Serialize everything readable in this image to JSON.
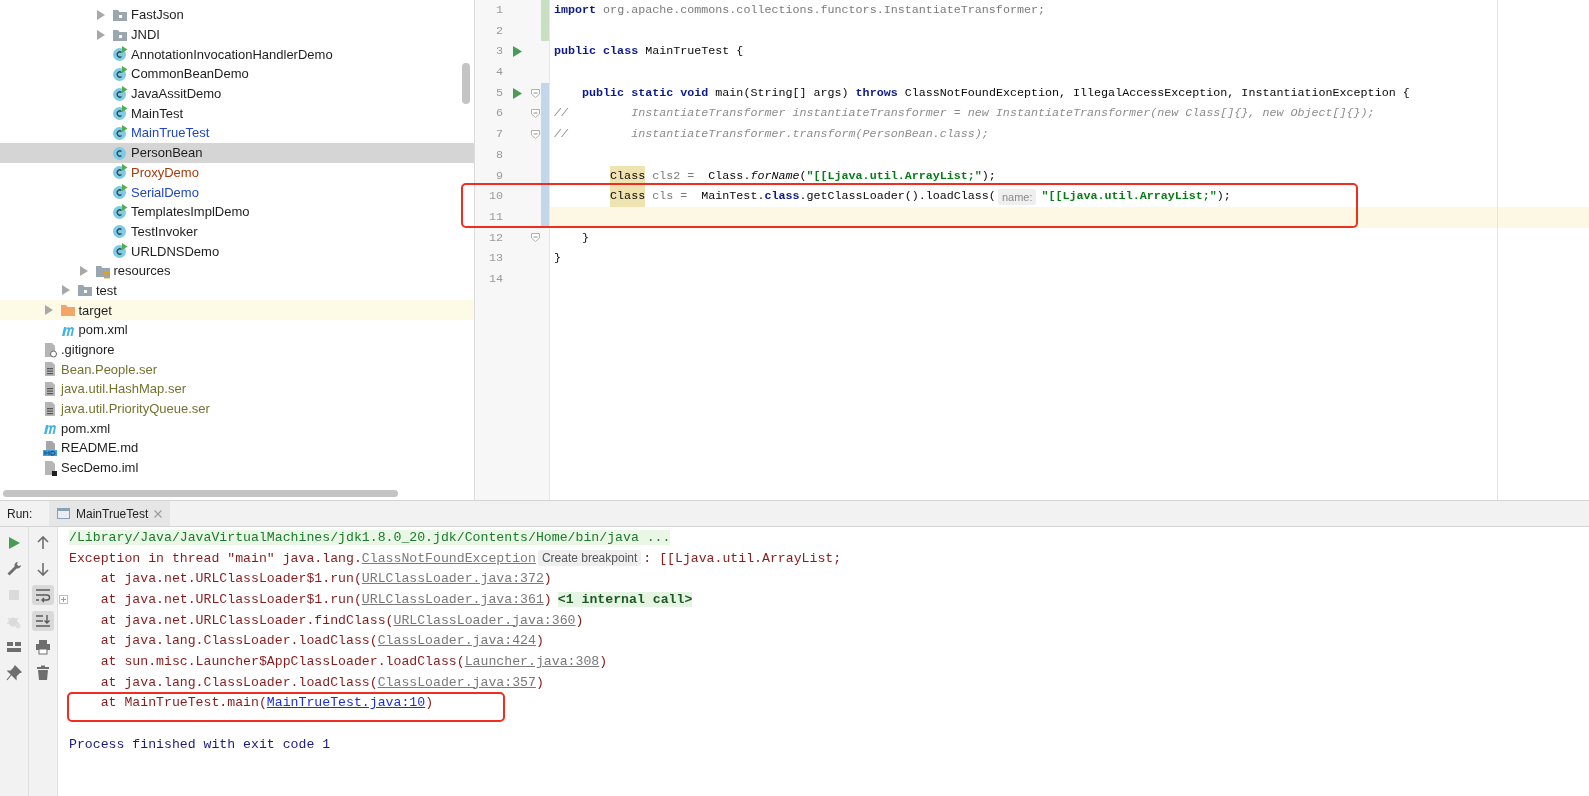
{
  "project_tree": {
    "items": [
      {
        "children": [
          {
            "children": [
              {
                "children": [
                  {
                    "children": [
                      {
                        "label": "FastJson",
                        "kind": "folder",
                        "color": "#1e1e1e",
                        "selected": false,
                        "expanded": false
                      },
                      {
                        "label": "JNDI",
                        "kind": "folder",
                        "color": "#1e1e1e",
                        "selected": false,
                        "expanded": false
                      },
                      {
                        "label": "AnnotationInvocationHandlerDemo",
                        "kind": "class-main",
                        "color": "#1e1e1e",
                        "selected": false
                      },
                      {
                        "label": "CommonBeanDemo",
                        "kind": "class-main",
                        "color": "#1e1e1e",
                        "selected": false
                      },
                      {
                        "label": "JavaAssitDemo",
                        "kind": "class-main",
                        "color": "#1e1e1e",
                        "selected": false
                      },
                      {
                        "label": "MainTest",
                        "kind": "class-main",
                        "color": "#1e1e1e",
                        "selected": false
                      },
                      {
                        "label": "MainTrueTest",
                        "kind": "class-main",
                        "color": "#1f46c8",
                        "selected": false
                      },
                      {
                        "label": "PersonBean",
                        "kind": "class",
                        "color": "#1e1e1e",
                        "selected": true
                      },
                      {
                        "label": "ProxyDemo",
                        "kind": "class-main",
                        "color": "#a8390a",
                        "selected": false
                      },
                      {
                        "label": "SerialDemo",
                        "kind": "class-main",
                        "color": "#1f46c8",
                        "selected": false
                      },
                      {
                        "label": "TemplatesImplDemo",
                        "kind": "class-main",
                        "color": "#1e1e1e",
                        "selected": false
                      },
                      {
                        "label": "TestInvoker",
                        "kind": "class",
                        "color": "#1e1e1e",
                        "selected": false
                      },
                      {
                        "label": "URLDNSDemo",
                        "kind": "class-main",
                        "color": "#1e1e1e",
                        "selected": false
                      }
                    ]
                  },
                  {
                    "label": "resources",
                    "kind": "resources",
                    "color": "#1e1e1e",
                    "selected": false,
                    "expanded": false
                  }
                ]
              },
              {
                "label": "test",
                "kind": "folder",
                "color": "#1e1e1e",
                "selected": false,
                "expanded": false
              }
            ]
          },
          {
            "label": "target",
            "kind": "excluded",
            "color": "#1e1e1e",
            "selected": false,
            "expanded": false
          },
          {
            "label": "pom.xml",
            "kind": "maven",
            "color": "#1e1e1e",
            "selected": false
          }
        ]
      },
      {
        "label": ".gitignore",
        "kind": "gitignore",
        "color": "#1e1e1e",
        "selected": false
      },
      {
        "label": "Bean.People.ser",
        "kind": "text-file",
        "color": "#737330",
        "selected": false
      },
      {
        "label": "java.util.HashMap.ser",
        "kind": "text-file",
        "color": "#737330",
        "selected": false
      },
      {
        "label": "java.util.PriorityQueue.ser",
        "kind": "text-file",
        "color": "#737330",
        "selected": false
      },
      {
        "label": "pom.xml",
        "kind": "maven",
        "color": "#1e1e1e",
        "selected": false
      },
      {
        "label": "README.md",
        "kind": "markdown",
        "color": "#1e1e1e",
        "selected": false
      },
      {
        "label": "SecDemo.iml",
        "kind": "iml",
        "color": "#1e1e1e",
        "selected": false
      }
    ]
  },
  "editor": {
    "lines": [
      {
        "number": "1",
        "kind": "added",
        "runnable": false,
        "fold": false,
        "current": false,
        "tokens": [
          {
            "kind": "keyword",
            "text": "import"
          },
          {
            "kind": "unused",
            "text": " org.apache.commons.collections.functors.InstantiateTransformer;"
          }
        ]
      },
      {
        "number": "2",
        "kind": "added",
        "runnable": false,
        "fold": false,
        "current": false
      },
      {
        "number": "3",
        "kind": "unchanged",
        "runnable": true,
        "fold": false,
        "current": false,
        "tokens": [
          {
            "kind": "keyword",
            "text": "public class"
          },
          {
            "kind": "plain",
            "text": " MainTrueTest {"
          }
        ]
      },
      {
        "number": "4",
        "kind": "unchanged",
        "runnable": false,
        "fold": false,
        "current": false
      },
      {
        "number": "5",
        "kind": "modified",
        "runnable": true,
        "fold": true,
        "current": false,
        "tokens": [
          {
            "kind": "keyword",
            "text": "    public static void"
          },
          {
            "kind": "plain",
            "text": " main(String[] args) "
          },
          {
            "kind": "keyword",
            "text": "throws"
          },
          {
            "kind": "plain",
            "text": " ClassNotFoundException, IllegalAccessException, InstantiationException {"
          }
        ]
      },
      {
        "number": "6",
        "kind": "modified",
        "runnable": false,
        "fold": true,
        "current": false,
        "tokens": [
          {
            "kind": "comment",
            "text": "//         InstantiateTransformer instantiateTransformer = new InstantiateTransformer(new Class[]{}, new Object[]{});"
          }
        ]
      },
      {
        "number": "7",
        "kind": "modified",
        "runnable": false,
        "fold": true,
        "current": false,
        "tokens": [
          {
            "kind": "comment",
            "text": "//         instantiateTransformer.transform(PersonBean.class);"
          }
        ]
      },
      {
        "number": "8",
        "kind": "modified",
        "runnable": false,
        "fold": false,
        "current": false
      },
      {
        "number": "9",
        "kind": "modified",
        "runnable": false,
        "fold": false,
        "current": false,
        "tokens": [
          {
            "kind": "usage",
            "text": "Class"
          },
          {
            "kind": "unused",
            "text": " cls2 ="
          },
          {
            "kind": "plain",
            "text": "  Class."
          },
          {
            "kind": "static",
            "text": "forName"
          },
          {
            "kind": "plain",
            "text": "("
          },
          {
            "kind": "string",
            "text": "\"[[Ljava.util.ArrayList;\""
          },
          {
            "kind": "plain",
            "text": ");"
          }
        ]
      },
      {
        "number": "10",
        "kind": "modified",
        "runnable": false,
        "fold": false,
        "current": false,
        "tokens": [
          {
            "kind": "usage",
            "text": "Class"
          },
          {
            "kind": "unused",
            "text": " cls ="
          },
          {
            "kind": "plain",
            "text": "  MainTest."
          },
          {
            "kind": "keyword",
            "text": "class"
          },
          {
            "kind": "plain",
            "text": ".getClassLoader().loadClass("
          },
          {
            "kind": "hint",
            "text": "name:"
          },
          {
            "kind": "string",
            "text": "\"[[Ljava.util.ArrayList;\""
          },
          {
            "kind": "plain",
            "text": ");"
          }
        ]
      },
      {
        "number": "11",
        "kind": "modified",
        "runnable": false,
        "fold": false,
        "current": true
      },
      {
        "number": "12",
        "kind": "unchanged",
        "runnable": false,
        "fold": true,
        "current": false,
        "tokens": [
          {
            "kind": "plain",
            "text": "    }"
          }
        ]
      },
      {
        "number": "13",
        "kind": "unchanged",
        "runnable": false,
        "fold": false,
        "current": false,
        "tokens": [
          {
            "kind": "plain",
            "text": "}"
          }
        ]
      },
      {
        "number": "14",
        "kind": "unchanged",
        "runnable": false,
        "fold": false,
        "current": false
      }
    ]
  },
  "run": {
    "label": "Run:",
    "tabs": [
      {
        "label": "MainTrueTest",
        "selected": true
      }
    ],
    "toolbar": [
      {
        "kind": "run",
        "disabled": false
      },
      {
        "kind": "wrench",
        "disabled": false
      },
      {
        "kind": "stop",
        "disabled": true
      },
      {
        "kind": "debug",
        "disabled": true
      },
      {
        "kind": "layout",
        "disabled": false
      },
      {
        "kind": "pin",
        "disabled": false
      }
    ],
    "toolbar_2": [
      {
        "kind": "up",
        "selected": false
      },
      {
        "kind": "down",
        "selected": false
      },
      {
        "kind": "wrap",
        "selected": true
      },
      {
        "kind": "scroll-end",
        "selected": true
      },
      {
        "kind": "print",
        "selected": false
      },
      {
        "kind": "trash",
        "selected": false
      }
    ],
    "console": [
      {
        "fold": false,
        "segments": [
          {
            "kind": "command",
            "text": "/Library/Java/JavaVirtualMachines/jdk1.8.0_20.jdk/Contents/Home/bin/java ..."
          }
        ]
      },
      {
        "fold": false,
        "segments": [
          {
            "kind": "error",
            "text": "Exception in thread \"main\" java.lang."
          },
          {
            "kind": "link",
            "text": "ClassNotFoundException"
          },
          {
            "kind": "chip",
            "text": "Create breakpoint"
          },
          {
            "kind": "error",
            "text": ": [[Ljava.util.ArrayList;"
          }
        ]
      },
      {
        "fold": false,
        "segments": [
          {
            "kind": "error",
            "text": "    at java.net.URLClassLoader$1.run("
          },
          {
            "kind": "link",
            "text": "URLClassLoader.java:372"
          },
          {
            "kind": "error",
            "text": ")"
          }
        ]
      },
      {
        "fold": true,
        "segments": [
          {
            "kind": "error",
            "text": "    at java.net.URLClassLoader$1.run("
          },
          {
            "kind": "link",
            "text": "URLClassLoader.java:361"
          },
          {
            "kind": "error",
            "text": ")"
          },
          {
            "kind": "internal",
            "text": "<1 internal call>"
          }
        ]
      },
      {
        "fold": false,
        "segments": [
          {
            "kind": "error",
            "text": "    at java.net.URLClassLoader.findClass("
          },
          {
            "kind": "link",
            "text": "URLClassLoader.java:360"
          },
          {
            "kind": "error",
            "text": ")"
          }
        ]
      },
      {
        "fold": false,
        "segments": [
          {
            "kind": "error",
            "text": "    at java.lang.ClassLoader.loadClass("
          },
          {
            "kind": "link",
            "text": "ClassLoader.java:424"
          },
          {
            "kind": "error",
            "text": ")"
          }
        ]
      },
      {
        "fold": false,
        "segments": [
          {
            "kind": "error",
            "text": "    at sun.misc.Launcher$AppClassLoader.loadClass("
          },
          {
            "kind": "link",
            "text": "Launcher.java:308"
          },
          {
            "kind": "error",
            "text": ")"
          }
        ]
      },
      {
        "fold": false,
        "segments": [
          {
            "kind": "error",
            "text": "    at java.lang.ClassLoader.loadClass("
          },
          {
            "kind": "link",
            "text": "ClassLoader.java:357"
          },
          {
            "kind": "error",
            "text": ")"
          }
        ]
      },
      {
        "fold": false,
        "segments": [
          {
            "kind": "error",
            "text": "    at MainTrueTest.main("
          },
          {
            "kind": "active-link",
            "text": "MainTrueTest.java:10"
          },
          {
            "kind": "error",
            "text": ")"
          }
        ]
      },
      {
        "fold": false
      },
      {
        "fold": false,
        "segments": [
          {
            "kind": "exit",
            "text": "Process finished with exit code 1"
          }
        ]
      }
    ]
  }
}
